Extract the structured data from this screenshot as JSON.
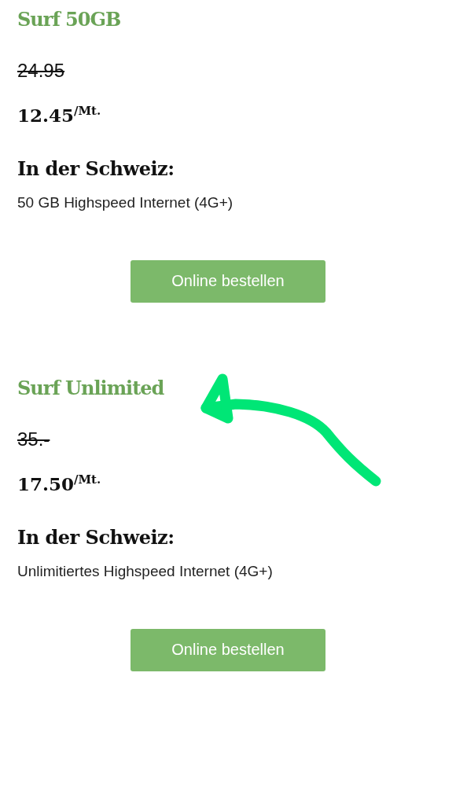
{
  "plans": [
    {
      "name": "Surf 50GB",
      "old_price": "24.95",
      "price": "12.45$^{/Mt.}$",
      "region": "In der Schweiz:",
      "feature": "50 GB Highspeed Internet (4G+)",
      "button": "Online bestellen"
    },
    {
      "name": "Surf Unlimited",
      "old_price": "35.-",
      "price": "17.50$^{/Mt.}$",
      "region": "In der Schweiz:",
      "feature": "Unlimitiertes Highspeed Internet (4G+)",
      "button": "Online bestellen"
    }
  ]
}
